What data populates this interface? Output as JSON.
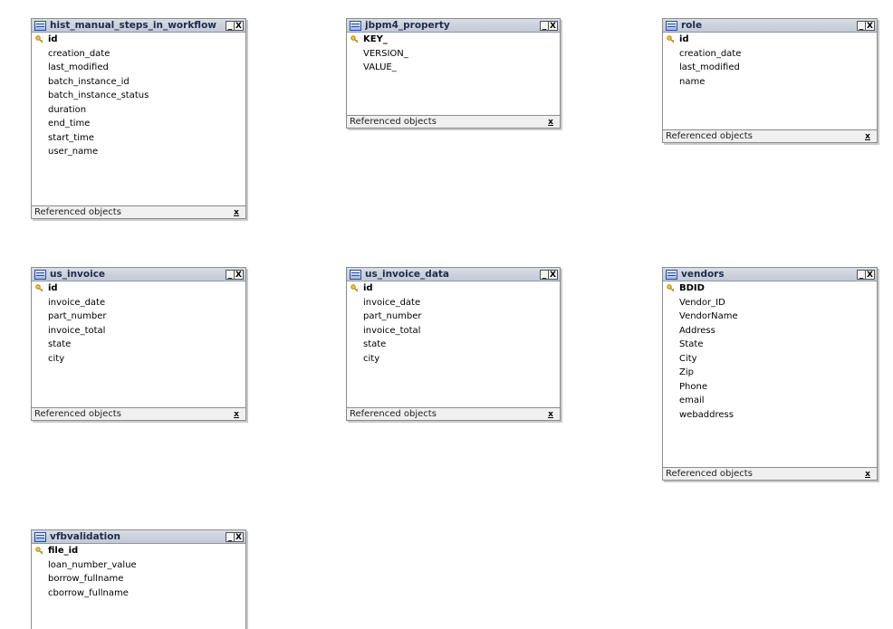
{
  "footer_label": "Referenced objects",
  "minimize_glyph": "_",
  "close_glyph": "X",
  "footer_close_glyph": "x",
  "tables": [
    {
      "id": "hist",
      "name": "hist_manual_steps_in_workflow",
      "primary_key": "id",
      "columns": [
        "creation_date",
        "last_modified",
        "batch_instance_id",
        "batch_instance_status",
        "duration",
        "end_time",
        "start_time",
        "user_name"
      ]
    },
    {
      "id": "jbpm",
      "name": "jbpm4_property",
      "primary_key": "KEY_",
      "columns": [
        "VERSION_",
        "VALUE_"
      ]
    },
    {
      "id": "role",
      "name": "role",
      "primary_key": "id",
      "columns": [
        "creation_date",
        "last_modified",
        "name"
      ]
    },
    {
      "id": "usinv",
      "name": "us_invoice",
      "primary_key": "id",
      "columns": [
        "invoice_date",
        "part_number",
        "invoice_total",
        "state",
        "city"
      ]
    },
    {
      "id": "usinvdata",
      "name": "us_invoice_data",
      "primary_key": "id",
      "columns": [
        "invoice_date",
        "part_number",
        "invoice_total",
        "state",
        "city"
      ]
    },
    {
      "id": "vendors",
      "name": "vendors",
      "primary_key": "BDID",
      "columns": [
        "Vendor_ID",
        "VendorName",
        "Address",
        "State",
        "City",
        "Zip",
        "Phone",
        "email",
        "webaddress"
      ]
    },
    {
      "id": "vfb",
      "name": "vfbvalidation",
      "primary_key": "file_id",
      "columns": [
        "loan_number_value",
        "borrow_fullname",
        "cborrow_fullname"
      ]
    }
  ]
}
